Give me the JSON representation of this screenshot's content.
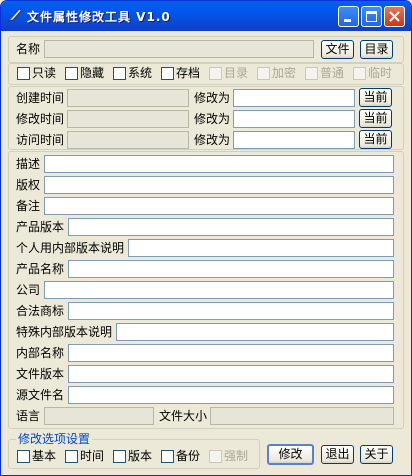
{
  "window": {
    "title": "文件属性修改工具 V1.0"
  },
  "name_row": {
    "label": "名称",
    "value": "",
    "file_button": "文件",
    "dir_button": "目录"
  },
  "attributes": [
    {
      "label": "只读",
      "enabled": true
    },
    {
      "label": "隐藏",
      "enabled": true
    },
    {
      "label": "系统",
      "enabled": true
    },
    {
      "label": "存档",
      "enabled": true
    },
    {
      "label": "目录",
      "enabled": false
    },
    {
      "label": "加密",
      "enabled": false
    },
    {
      "label": "普通",
      "enabled": false
    },
    {
      "label": "临时",
      "enabled": false
    }
  ],
  "times": [
    {
      "label": "创建时间",
      "current": "",
      "modify_label": "修改为",
      "new_value": "",
      "now_button": "当前"
    },
    {
      "label": "修改时间",
      "current": "",
      "modify_label": "修改为",
      "new_value": "",
      "now_button": "当前"
    },
    {
      "label": "访问时间",
      "current": "",
      "modify_label": "修改为",
      "new_value": "",
      "now_button": "当前"
    }
  ],
  "version_fields": [
    {
      "label": "描述",
      "value": ""
    },
    {
      "label": "版权",
      "value": ""
    },
    {
      "label": "备注",
      "value": ""
    },
    {
      "label": "产品版本",
      "value": ""
    },
    {
      "label": "个人用内部版本说明",
      "value": ""
    },
    {
      "label": "产品名称",
      "value": ""
    },
    {
      "label": "公司",
      "value": ""
    },
    {
      "label": "合法商标",
      "value": ""
    },
    {
      "label": "特殊内部版本说明",
      "value": ""
    },
    {
      "label": "内部名称",
      "value": ""
    },
    {
      "label": "文件版本",
      "value": ""
    },
    {
      "label": "源文件名",
      "value": ""
    }
  ],
  "info": {
    "language_label": "语言",
    "language_value": "",
    "size_label": "文件大小",
    "size_value": ""
  },
  "options": {
    "legend": "修改选项设置",
    "checks": [
      {
        "label": "基本",
        "enabled": true
      },
      {
        "label": "时间",
        "enabled": true
      },
      {
        "label": "版本",
        "enabled": true
      },
      {
        "label": "备份",
        "enabled": true
      },
      {
        "label": "强制",
        "enabled": false
      }
    ],
    "modify_button": "修改",
    "exit_button": "退出",
    "about_button": "关于"
  },
  "colors": {
    "titlebar": "#0058ee",
    "window_bg": "#ece9d8",
    "legend_text": "#0046d5"
  }
}
